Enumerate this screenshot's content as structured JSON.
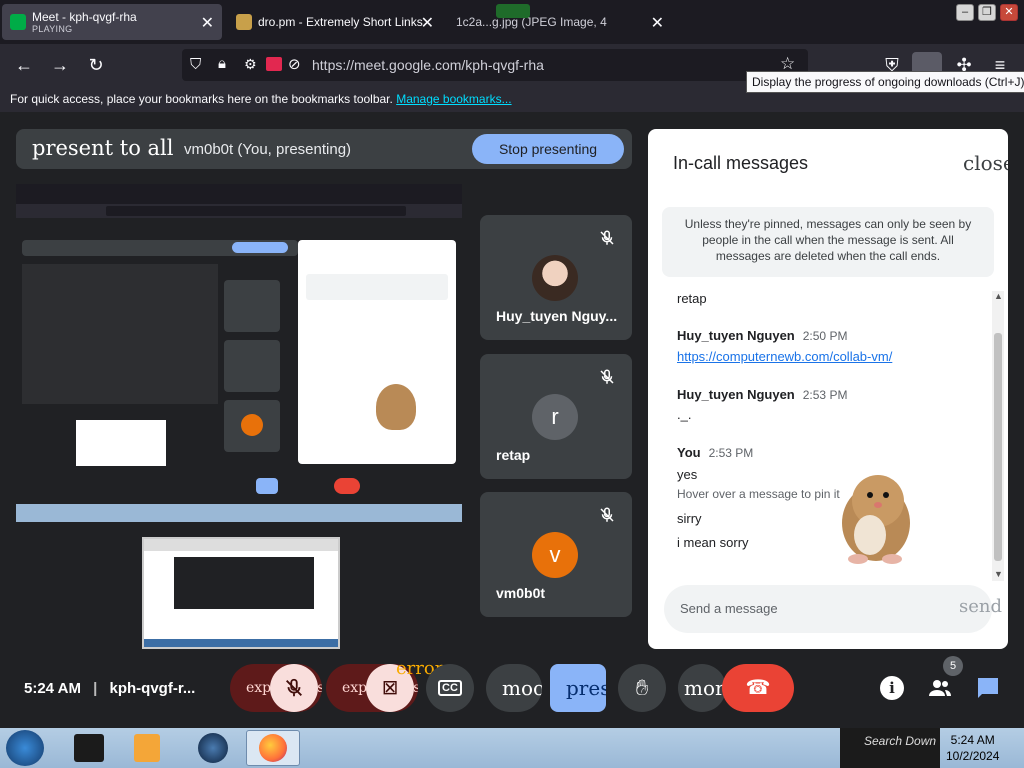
{
  "browser": {
    "tabs": [
      {
        "title": "Meet - kph-qvgf-rha",
        "subtitle": "PLAYING"
      },
      {
        "title": "dro.pm - Extremely Short Links"
      },
      {
        "title": "1c2a...g.jpg (JPEG Image, 4"
      }
    ],
    "url": "https://meet.google.com/kph-qvgf-rha",
    "tooltip": "Display the progress of ongoing downloads (Ctrl+J)",
    "bookmarks_text": "For quick access, place your bookmarks here on the bookmarks toolbar.",
    "bookmarks_link": "Manage bookmarks..."
  },
  "meet": {
    "present_label": "present to all",
    "presenter": "vm0b0t (You, presenting)",
    "stop_button": "Stop presenting",
    "participants": [
      {
        "name": "Huy_tuyen Nguy...",
        "avatar": ""
      },
      {
        "name": "retap",
        "avatar": "r",
        "color": "#5f6368"
      },
      {
        "name": "vm0b0t",
        "avatar": "v",
        "color": "#e8710a"
      }
    ],
    "chat": {
      "title": "In-call messages",
      "close": "close",
      "info": "Unless they're pinned, messages can only be seen by people in the call when the message is sent. All messages are deleted when the call ends.",
      "messages": {
        "m0": "retap",
        "s1": "Huy_tuyen Nguyen",
        "t1": "2:50 PM",
        "m1": "https://computernewb.com/collab-vm/",
        "s2": "Huy_tuyen Nguyen",
        "t2": "2:53 PM",
        "m2": "._.",
        "s3": "You",
        "t3": "2:53 PM",
        "m3": "yes",
        "hover": "Hover over a message to pin it",
        "m4": "sirry",
        "m5": "i mean sorry"
      },
      "input_placeholder": "Send a message",
      "send": "send"
    },
    "bottom": {
      "time": "5:24 AM",
      "meeting_code": "kph-qvgf-r...",
      "expand1": "expand_less",
      "expand2": "expand_less",
      "error": "error",
      "mood": "mood",
      "present": "present_to_all",
      "more": "more_vert",
      "people_count": "5"
    },
    "accent": "#8ab4f8",
    "hangup_color": "#ea4335"
  },
  "taskbar": {
    "search": "Search Down",
    "time": "5:24 AM",
    "date": "10/2/2024"
  }
}
